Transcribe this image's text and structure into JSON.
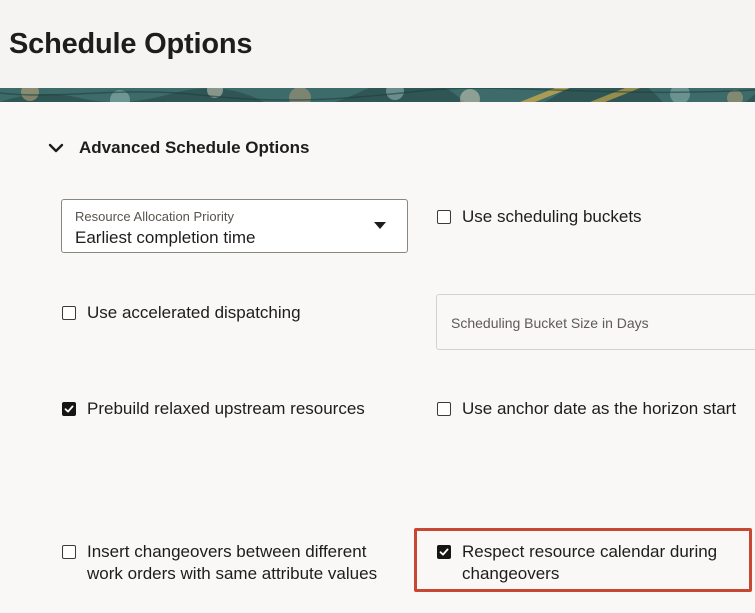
{
  "page": {
    "title": "Schedule Options"
  },
  "section": {
    "title": "Advanced Schedule Options",
    "expanded": true
  },
  "allocation_select": {
    "label": "Resource Allocation Priority",
    "value": "Earliest completion time"
  },
  "options": {
    "use_scheduling_buckets": {
      "label": "Use scheduling buckets",
      "checked": false
    },
    "use_accelerated_dispatching": {
      "label": "Use accelerated dispatching",
      "checked": false
    },
    "prebuild_relaxed": {
      "label": "Prebuild relaxed upstream resources",
      "checked": true
    },
    "anchor_date": {
      "label": "Use anchor date as the horizon start",
      "checked": false
    },
    "insert_changeovers": {
      "line1": "Insert changeovers between different",
      "line2": "work orders with same attribute values",
      "checked": false
    },
    "respect_calendar": {
      "line1": "Respect resource calendar during",
      "line2": "changeovers",
      "checked": true
    }
  },
  "bucket_size_field": {
    "placeholder": "Scheduling Bucket Size in Days"
  },
  "colors": {
    "highlight": "#c74634",
    "checkbox_checked": "#161513",
    "banner_primary": "#3d6b6a"
  }
}
